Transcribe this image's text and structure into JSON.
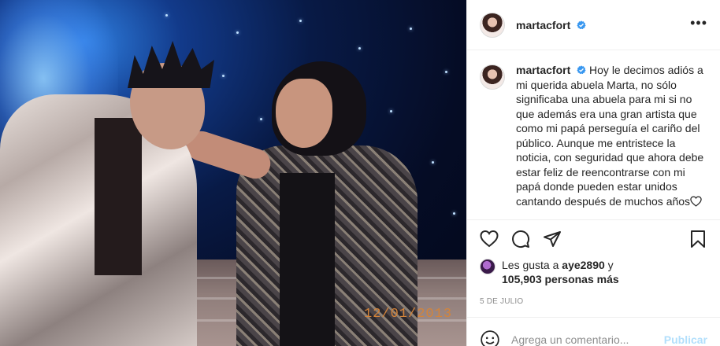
{
  "post": {
    "photo": {
      "date_stamp": "12/01/2013"
    },
    "header": {
      "username": "martacfort",
      "verified_icon": "verified-badge-icon",
      "more_icon": "more-options-icon"
    },
    "caption": {
      "username": "martacfort",
      "text": "Hoy le decimos adiós a mi querida abuela Marta, no sólo significaba una abuela para mi si no que además era una gran artista que como mi papá perseguía el cariño del público. Aunque me entristece la noticia, con seguridad que ahora debe estar feliz de reencontrarse con mi papá donde pueden estar unidos cantando después de muchos años"
    },
    "actions": [
      "heart-icon",
      "comment-icon",
      "share-icon",
      "bookmark-icon"
    ],
    "likes": {
      "prefix": "Les gusta a ",
      "user": "aye2890",
      "middle": " y",
      "count": "105,903 personas más"
    },
    "date": "5 DE JULIO",
    "comment": {
      "placeholder": "Agrega un comentario...",
      "publish_label": "Publicar",
      "emoji_icon": "emoji-icon"
    },
    "colors": {
      "accent": "#0095f6",
      "publish_disabled": "#b2dffc",
      "muted": "#8e8e8e"
    }
  }
}
